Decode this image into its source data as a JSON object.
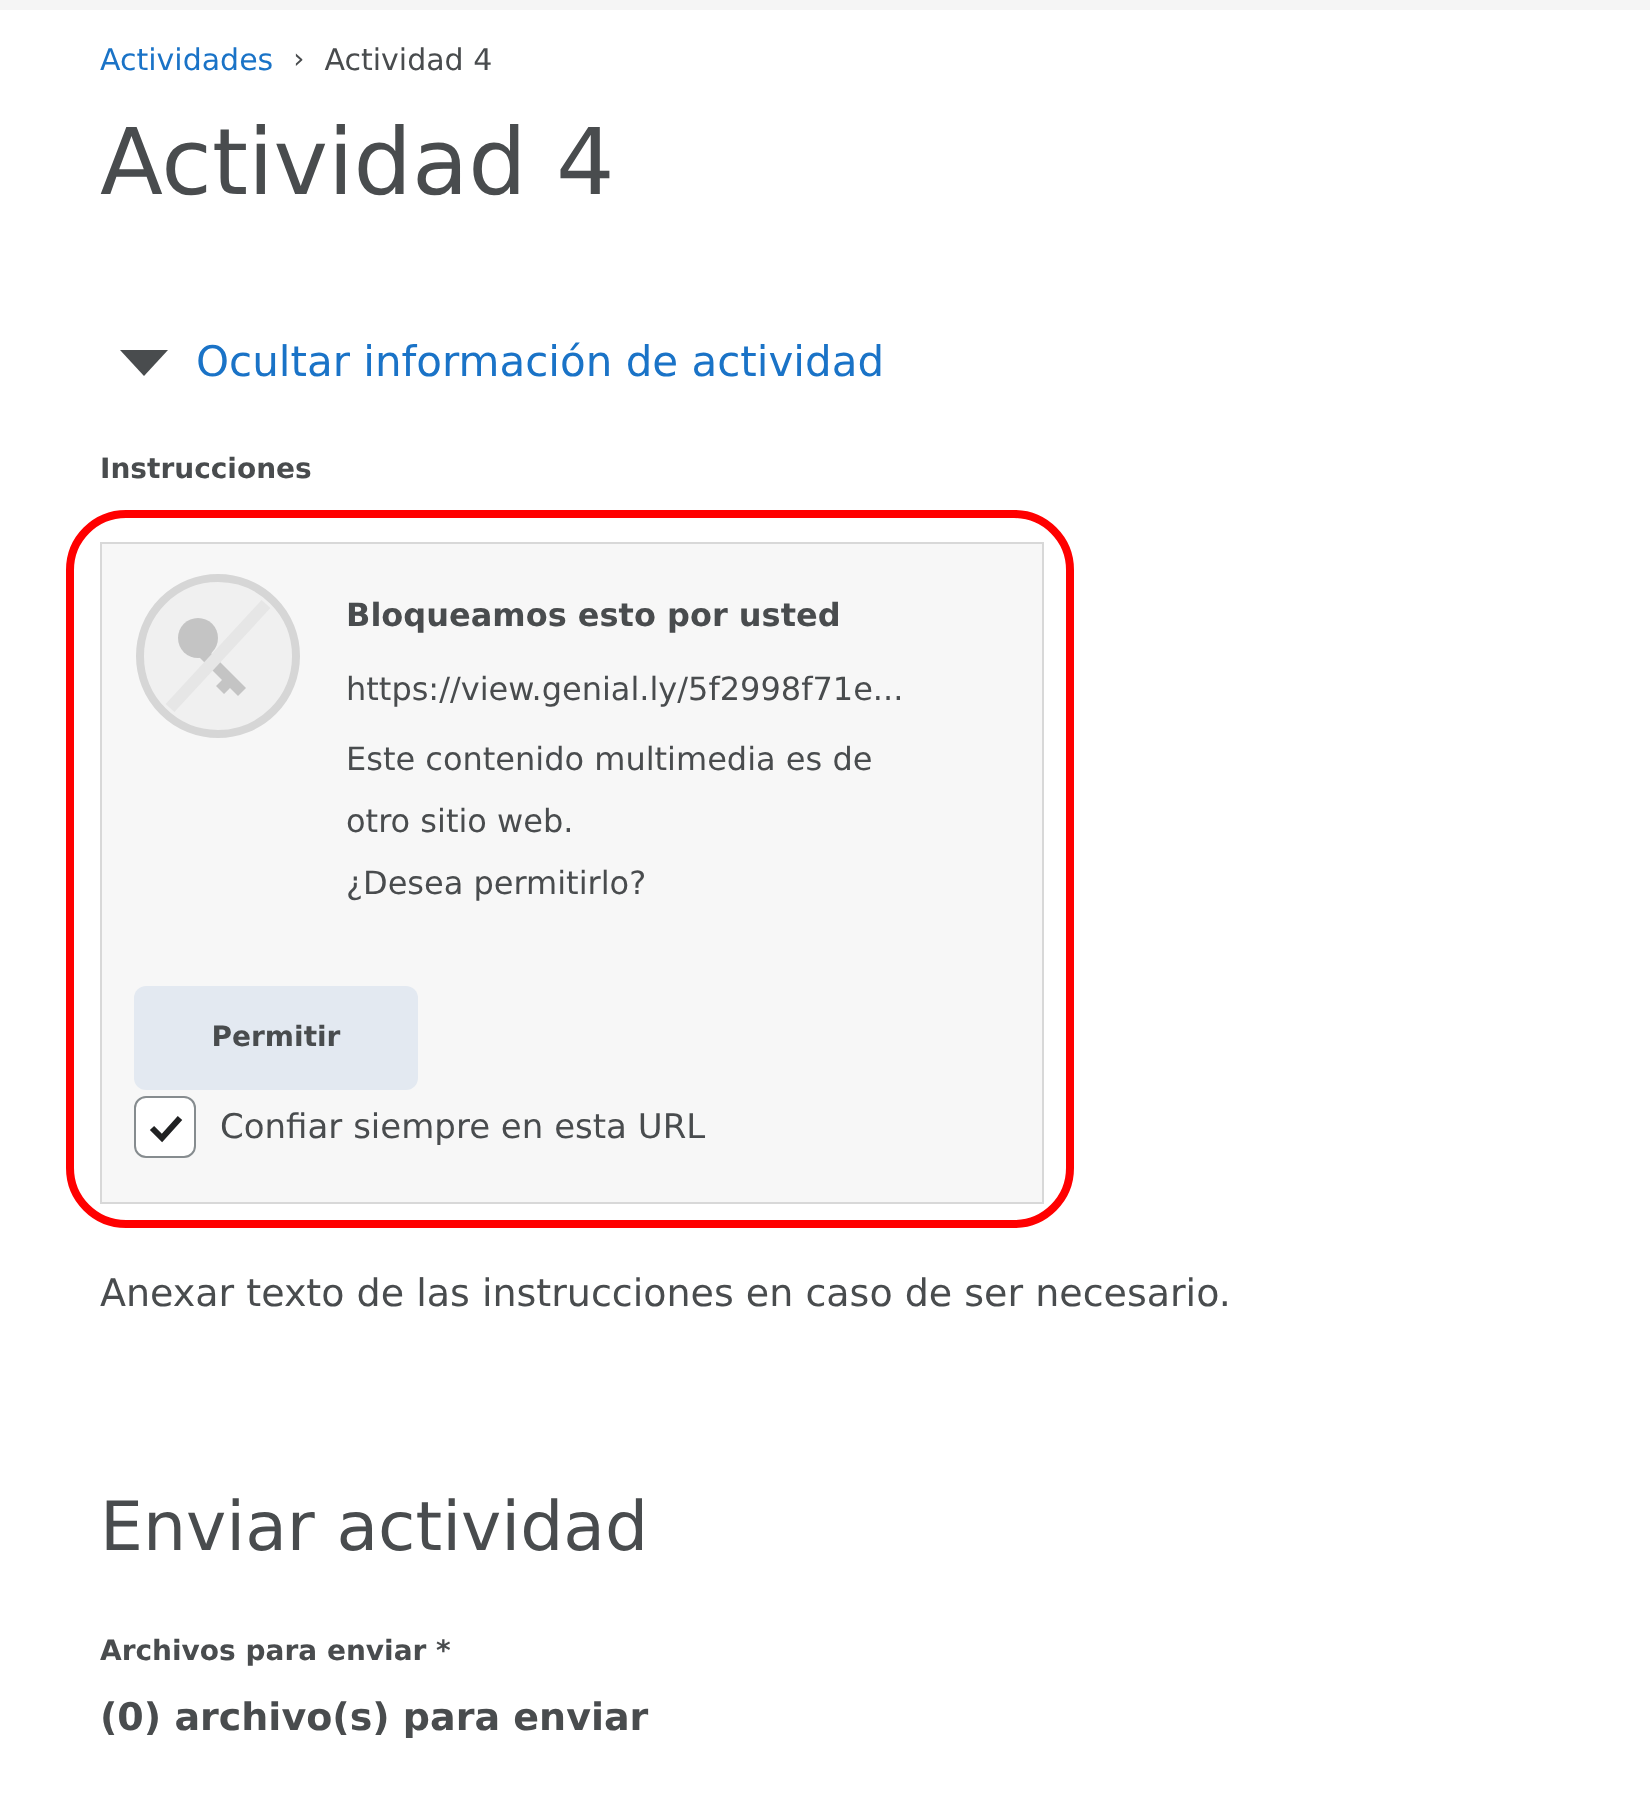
{
  "breadcrumb": {
    "link": "Actividades",
    "separator": "›",
    "current": "Actividad 4"
  },
  "title": "Actividad 4",
  "toggle": {
    "label": "Ocultar información de actividad",
    "expanded": true
  },
  "instructions_label": "Instrucciones",
  "blocked_card": {
    "title": "Bloqueamos esto por usted",
    "url": "https://view.genial.ly/5f2998f71e...",
    "lines": [
      "Este contenido multimedia es de",
      "otro sitio web.",
      "¿Desea permitirlo?"
    ],
    "button": "Permitir",
    "trust": {
      "label": "Confiar siempre en esta URL",
      "checked": true
    }
  },
  "instructions_text": "Anexar texto de las instrucciones en caso de ser necesario.",
  "submit_heading": "Enviar actividad",
  "files_label": "Archivos para enviar *",
  "files_count": "(0) archivo(s) para enviar"
}
